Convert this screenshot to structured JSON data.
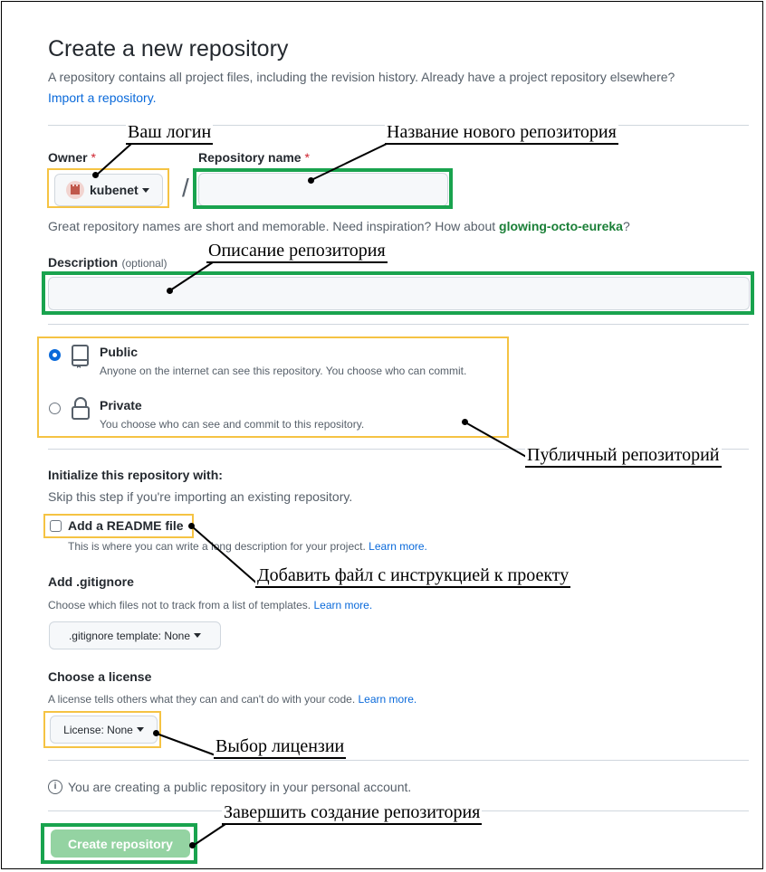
{
  "header": {
    "title": "Create a new repository",
    "subtitle": "A repository contains all project files, including the revision history. Already have a project repository elsewhere?",
    "import_link": "Import a repository."
  },
  "owner": {
    "label": "Owner",
    "required_mark": "*",
    "value": "kubenet"
  },
  "repo_name": {
    "label": "Repository name",
    "required_mark": "*",
    "value": "",
    "separator": "/"
  },
  "name_hint": {
    "text": "Great repository names are short and memorable. Need inspiration? How about",
    "suggestion": "glowing-octo-eureka",
    "end": "?"
  },
  "description": {
    "label": "Description",
    "optional": "(optional)",
    "value": ""
  },
  "visibility": {
    "selected": "public",
    "public": {
      "title": "Public",
      "desc": "Anyone on the internet can see this repository. You choose who can commit."
    },
    "private": {
      "title": "Private",
      "desc": "You choose who can see and commit to this repository."
    }
  },
  "init": {
    "title": "Initialize this repository with:",
    "subtitle": "Skip this step if you're importing an existing repository.",
    "readme_label": "Add a README file",
    "readme_checked": false,
    "readme_desc": "This is where you can write a long description for your project.",
    "readme_link": "Learn more."
  },
  "gitignore": {
    "title": "Add .gitignore",
    "desc": "Choose which files not to track from a list of templates.",
    "link": "Learn more.",
    "button": ".gitignore template: None"
  },
  "license": {
    "title": "Choose a license",
    "desc": "A license tells others what they can and can't do with your code.",
    "link": "Learn more.",
    "button": "License: None"
  },
  "info": {
    "text": "You are creating a public repository in your personal account."
  },
  "submit": {
    "label": "Create repository"
  },
  "annotations": {
    "login": "Ваш логин",
    "repo_name": "Название нового репозитория",
    "description": "Описание репозитория",
    "public": "Публичный репозиторий",
    "readme": "Добавить файл с инструкцией к проекту",
    "license": "Выбор лицензии",
    "create": "Завершить создание репозитория"
  },
  "colors": {
    "highlight_yellow": "#f5c343",
    "highlight_green": "#19a34e",
    "link": "#0969da",
    "suggestion": "#1a7f37"
  }
}
